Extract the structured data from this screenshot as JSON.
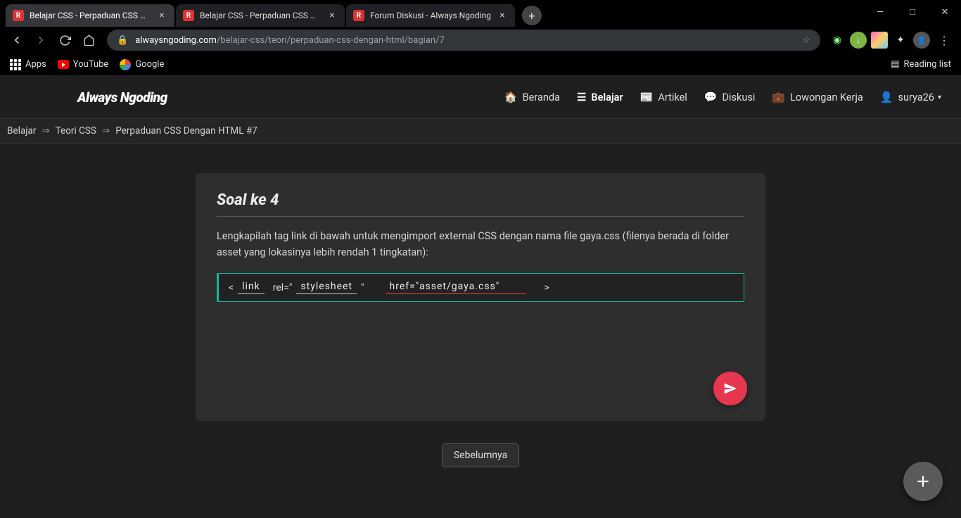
{
  "window": {
    "min": "—",
    "max": "□",
    "close": "✕"
  },
  "tabs": [
    {
      "title": "Belajar CSS - Perpaduan CSS Den"
    },
    {
      "title": "Belajar CSS - Perpaduan CSS Den"
    },
    {
      "title": "Forum Diskusi - Always Ngoding"
    }
  ],
  "omnibox": {
    "domain": "alwaysngoding.com",
    "path": "/belajar-css/teori/perpaduan-css-dengan-html/bagian/7"
  },
  "bookmarks": {
    "apps": "Apps",
    "youtube": "YouTube",
    "google": "Google",
    "reading": "Reading list"
  },
  "nav": {
    "brand": "Always Ngoding",
    "links": {
      "home": "Beranda",
      "learn": "Belajar",
      "article": "Artikel",
      "discuss": "Diskusi",
      "jobs": "Lowongan Kerja",
      "user": "surya26"
    }
  },
  "breadcrumb": {
    "a": "Belajar",
    "b": "Teori CSS",
    "c": "Perpaduan CSS Dengan HTML #7"
  },
  "card": {
    "title": "Soal ke 4",
    "desc": "Lengkapilah tag link di bawah untuk mengimport external CSS dengan nama file gaya.css (filenya berada di folder asset yang lokasinya lebih rendah 1 tingkatan):",
    "code": {
      "open": "<",
      "tag": "link",
      "rel_label": "rel=\"",
      "rel_val": "stylesheet",
      "rel_close": "\"",
      "href": "href=\"asset/gaya.css\"",
      "close": ">"
    }
  },
  "prev": "Sebelumnya"
}
